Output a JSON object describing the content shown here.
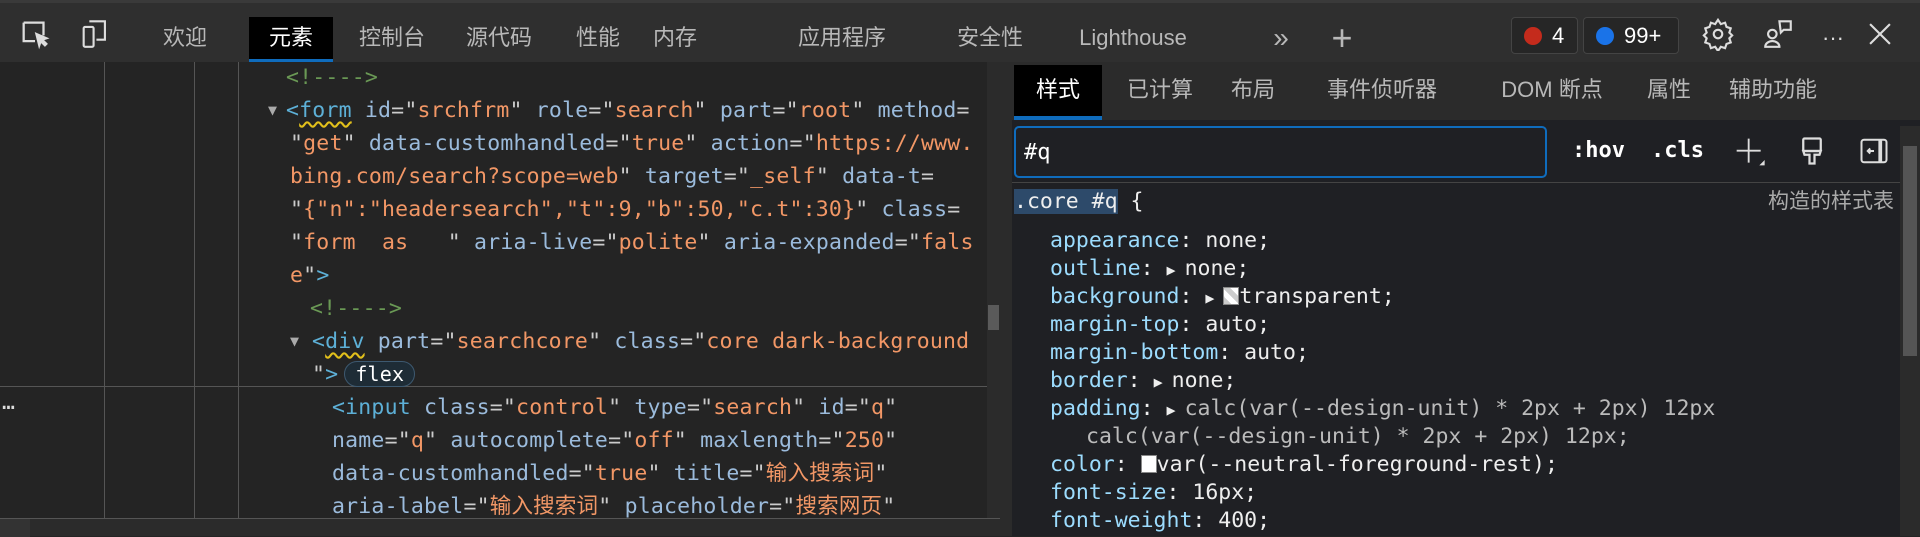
{
  "toolbar": {
    "tabs": [
      {
        "label": "欢迎",
        "active": false
      },
      {
        "label": "元素",
        "active": true
      },
      {
        "label": "控制台",
        "active": false
      },
      {
        "label": "源代码",
        "active": false
      },
      {
        "label": "性能",
        "active": false
      },
      {
        "label": "内存",
        "active": false
      },
      {
        "label": "应用程序",
        "active": false
      },
      {
        "label": "安全性",
        "active": false
      },
      {
        "label": "Lighthouse",
        "active": false
      }
    ],
    "more_tabs": "»",
    "add_tab": "+",
    "error_count": "4",
    "message_count": "99+",
    "colors": {
      "accent": "#0f6cbd",
      "error": "#c42b1c",
      "message": "#1a73e8"
    }
  },
  "dom": {
    "lines": [
      [
        [
          "cm",
          "<!---->"
        ]
      ],
      [
        [
          "tg",
          "<"
        ],
        [
          "tgs",
          "form"
        ],
        [
          "an",
          " id"
        ],
        [
          "pl",
          "=\""
        ],
        [
          "av",
          "srchfrm"
        ],
        [
          "pl",
          "\""
        ],
        [
          "an",
          " role"
        ],
        [
          "pl",
          "=\""
        ],
        [
          "av",
          "search"
        ],
        [
          "pl",
          "\""
        ],
        [
          "an",
          " part"
        ],
        [
          "pl",
          "=\""
        ],
        [
          "av",
          "root"
        ],
        [
          "pl",
          "\""
        ],
        [
          "an",
          " method"
        ],
        [
          "pl",
          "="
        ]
      ],
      [
        [
          "pl",
          "\""
        ],
        [
          "av",
          "get"
        ],
        [
          "pl",
          "\""
        ],
        [
          "an",
          " data-customhandled"
        ],
        [
          "pl",
          "=\""
        ],
        [
          "av",
          "true"
        ],
        [
          "pl",
          "\""
        ],
        [
          "an",
          " action"
        ],
        [
          "pl",
          "=\""
        ],
        [
          "av",
          "https://www."
        ]
      ],
      [
        [
          "av",
          "bing.com/search?scope=web"
        ],
        [
          "pl",
          "\""
        ],
        [
          "an",
          " target"
        ],
        [
          "pl",
          "=\""
        ],
        [
          "av",
          "_self"
        ],
        [
          "pl",
          "\""
        ],
        [
          "an",
          " data-t"
        ],
        [
          "pl",
          "="
        ]
      ],
      [
        [
          "pl",
          "\""
        ],
        [
          "av",
          "{\"n\":\"headersearch\",\"t\":9,\"b\":50,\"c.t\":30}"
        ],
        [
          "pl",
          "\""
        ],
        [
          "an",
          " class"
        ],
        [
          "pl",
          "="
        ]
      ],
      [
        [
          "pl",
          "\""
        ],
        [
          "av",
          "form  as   "
        ],
        [
          "pl",
          "\""
        ],
        [
          "an",
          " aria-live"
        ],
        [
          "pl",
          "=\""
        ],
        [
          "av",
          "polite"
        ],
        [
          "pl",
          "\""
        ],
        [
          "an",
          " aria-expanded"
        ],
        [
          "pl",
          "=\""
        ],
        [
          "av",
          "fals"
        ]
      ],
      [
        [
          "av",
          "e"
        ],
        [
          "pl",
          "\""
        ],
        [
          "tg",
          ">"
        ]
      ],
      [
        [
          "cm",
          "<!---->"
        ]
      ],
      [
        [
          "tg",
          "<"
        ],
        [
          "tgs",
          "div"
        ],
        [
          "an",
          " part"
        ],
        [
          "pl",
          "=\""
        ],
        [
          "av",
          "searchcore"
        ],
        [
          "pl",
          "\""
        ],
        [
          "an",
          " class"
        ],
        [
          "pl",
          "=\""
        ],
        [
          "av",
          "core dark-background"
        ]
      ],
      [
        [
          "pl",
          "\""
        ],
        [
          "tg",
          ">"
        ]
      ],
      [
        [
          "tg",
          "<input"
        ],
        [
          "an",
          " class"
        ],
        [
          "pl",
          "=\""
        ],
        [
          "av",
          "control"
        ],
        [
          "pl",
          "\""
        ],
        [
          "an",
          " type"
        ],
        [
          "pl",
          "=\""
        ],
        [
          "av",
          "search"
        ],
        [
          "pl",
          "\""
        ],
        [
          "an",
          " id"
        ],
        [
          "pl",
          "=\""
        ],
        [
          "av",
          "q"
        ],
        [
          "pl",
          "\""
        ]
      ],
      [
        [
          "an",
          "name"
        ],
        [
          "pl",
          "=\""
        ],
        [
          "av",
          "q"
        ],
        [
          "pl",
          "\""
        ],
        [
          "an",
          " autocomplete"
        ],
        [
          "pl",
          "=\""
        ],
        [
          "av",
          "off"
        ],
        [
          "pl",
          "\""
        ],
        [
          "an",
          " maxlength"
        ],
        [
          "pl",
          "=\""
        ],
        [
          "av",
          "250"
        ],
        [
          "pl",
          "\""
        ]
      ],
      [
        [
          "an",
          "data-customhandled"
        ],
        [
          "pl",
          "=\""
        ],
        [
          "av",
          "true"
        ],
        [
          "pl",
          "\""
        ],
        [
          "an",
          " title"
        ],
        [
          "pl",
          "=\""
        ],
        [
          "av",
          "输入搜索词"
        ],
        [
          "pl",
          "\""
        ]
      ],
      [
        [
          "an",
          "aria-label"
        ],
        [
          "pl",
          "=\""
        ],
        [
          "av",
          "输入搜索词"
        ],
        [
          "pl",
          "\""
        ],
        [
          "an",
          " placeholder"
        ],
        [
          "pl",
          "=\""
        ],
        [
          "av",
          "搜索网页"
        ],
        [
          "pl",
          "\""
        ]
      ]
    ],
    "flex_badge": "flex",
    "ellipsis": "…"
  },
  "styles": {
    "tabs": [
      {
        "label": "样式",
        "active": true
      },
      {
        "label": "已计算",
        "active": false
      },
      {
        "label": "布局",
        "active": false
      },
      {
        "label": "事件侦听器",
        "active": false
      },
      {
        "label": "DOM 断点",
        "active": false
      },
      {
        "label": "属性",
        "active": false
      },
      {
        "label": "辅助功能",
        "active": false
      }
    ],
    "filter_value": "#q",
    "hov": ":hov",
    "cls": ".cls",
    "selector": ".core #q",
    "brace_open": " {",
    "source": "构造的样式表",
    "props": [
      {
        "name": "appearance",
        "value": "none;"
      },
      {
        "name": "outline",
        "value": "none;",
        "expand": true
      },
      {
        "name": "background",
        "value": "transparent;",
        "expand": true,
        "swatch": "transparent"
      },
      {
        "name": "margin-top",
        "value": "auto;"
      },
      {
        "name": "margin-bottom",
        "value": "auto;"
      },
      {
        "name": "border",
        "value": "none;",
        "expand": true
      },
      {
        "name": "padding",
        "value": "calc(var(--design-unit) * 2px + 2px) 12px",
        "expand": true
      },
      {
        "name": "",
        "value": "calc(var(--design-unit) * 2px + 2px) 12px;",
        "cont": true
      },
      {
        "name": "color",
        "value": "var(--neutral-foreground-rest);",
        "swatch": "#ffffff"
      },
      {
        "name": "font-size",
        "value": "16px;"
      },
      {
        "name": "font-weight",
        "value": "400;"
      }
    ]
  }
}
